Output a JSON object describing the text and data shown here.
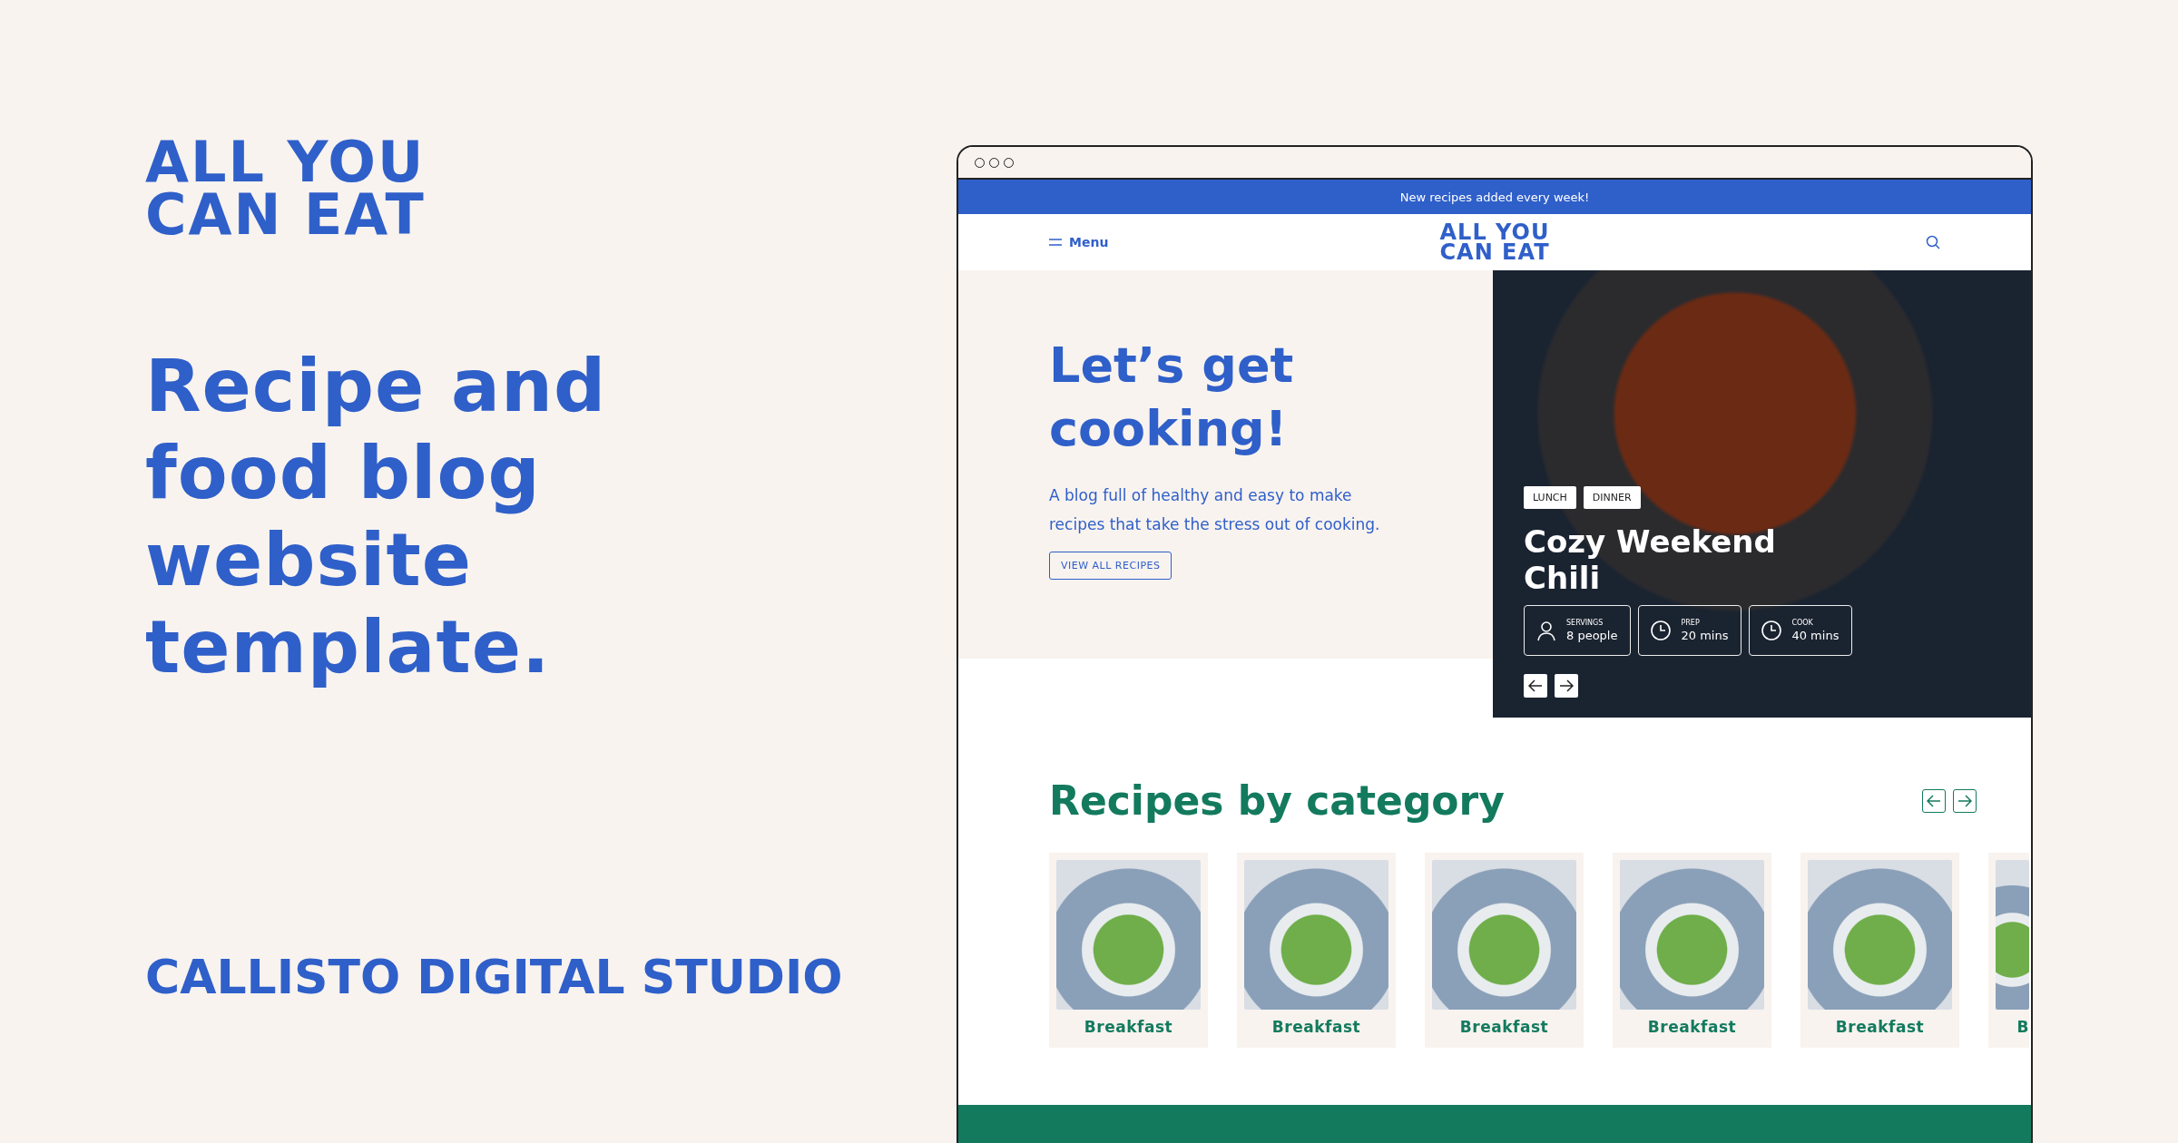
{
  "brand": {
    "logo_lines": [
      "ALL YOU",
      "CAN EAT"
    ],
    "tagline": "Recipe and food blog website template.",
    "studio": "CALLISTO DIGITAL STUDIO"
  },
  "browser": {
    "announcement": "New recipes added every week!",
    "nav": {
      "menu_label": "Menu",
      "logo_lines": [
        "ALL YOU",
        "CAN EAT"
      ]
    },
    "hero": {
      "title": "Let’s get cooking!",
      "text": "A blog full of healthy and easy to make recipes that take the stress out of cooking.",
      "button": "VIEW ALL RECIPES"
    },
    "featured": {
      "tags": [
        "LUNCH",
        "DINNER"
      ],
      "title": "Cozy Weekend Chili",
      "stats": [
        {
          "kind": "servings",
          "label": "SERVINGS",
          "value": "8 people"
        },
        {
          "kind": "prep",
          "label": "PREP",
          "value": "20 mins"
        },
        {
          "kind": "cook",
          "label": "COOK",
          "value": "40 mins"
        }
      ]
    },
    "categories": {
      "title": "Recipes by category",
      "cards": [
        {
          "label": "Breakfast"
        },
        {
          "label": "Breakfast"
        },
        {
          "label": "Breakfast"
        },
        {
          "label": "Breakfast"
        },
        {
          "label": "Breakfast"
        },
        {
          "label": "B",
          "partial": true
        }
      ]
    }
  }
}
